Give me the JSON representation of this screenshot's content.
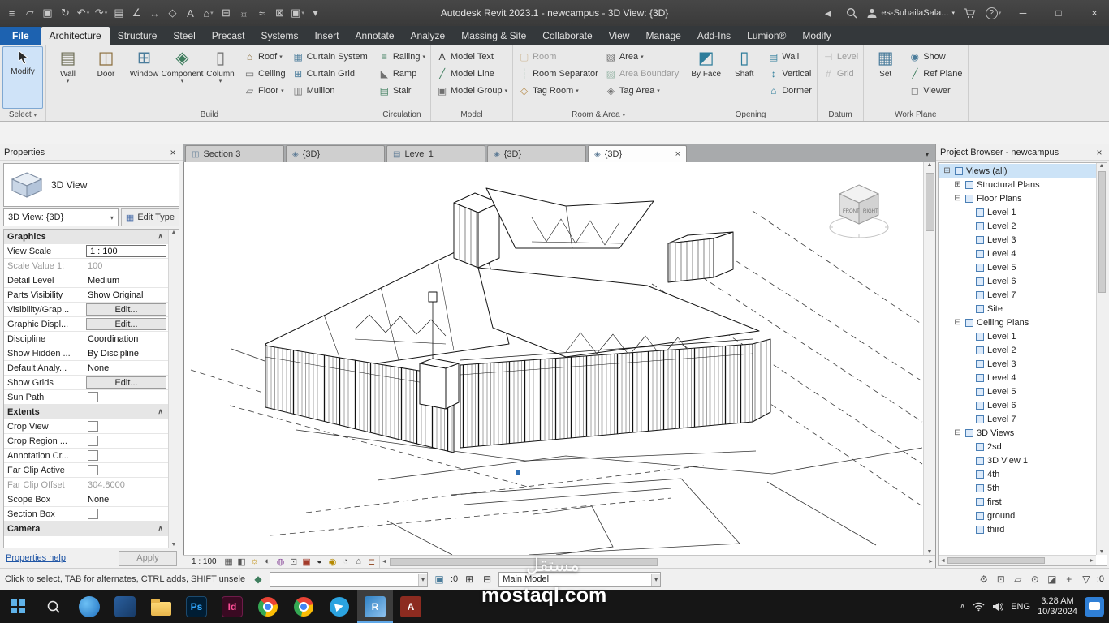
{
  "ui": {
    "arrow": "▾",
    "close": "×",
    "chev": "∧",
    "up": "▲",
    "down": "▼",
    "left": "◄",
    "right": "►",
    "min": "─",
    "max": "□",
    "help": "?"
  },
  "titlebar": {
    "title": "Autodesk Revit 2023.1 - newcampus - 3D View: {3D}",
    "user": "es-SuhailaSala...",
    "qat": [
      {
        "name": "app-menu-icon",
        "glyph": "≡"
      },
      {
        "name": "open-icon",
        "glyph": "▱"
      },
      {
        "name": "save-icon",
        "glyph": "▣"
      },
      {
        "name": "sync-icon",
        "glyph": "↻"
      },
      {
        "name": "undo-icon",
        "glyph": "↶",
        "arrow": true
      },
      {
        "name": "redo-icon",
        "glyph": "↷",
        "arrow": true
      },
      {
        "name": "print-icon",
        "glyph": "▤"
      },
      {
        "name": "measure-icon",
        "glyph": "∠"
      },
      {
        "name": "dimension-icon",
        "glyph": "↔"
      },
      {
        "name": "tag-icon",
        "glyph": "◇"
      },
      {
        "name": "text-icon",
        "glyph": "A"
      },
      {
        "name": "3d-view-icon",
        "glyph": "⌂",
        "arrow": true
      },
      {
        "name": "section-icon",
        "glyph": "⊟"
      },
      {
        "name": "render-icon",
        "glyph": "☼"
      },
      {
        "name": "thin-lines-icon",
        "glyph": "≈"
      },
      {
        "name": "close-hidden-icon",
        "glyph": "⊠"
      },
      {
        "name": "switch-windows-icon",
        "glyph": "▣",
        "arrow": true
      },
      {
        "name": "customize-qat-icon",
        "glyph": "▾"
      }
    ]
  },
  "ribbon": {
    "tabs": [
      {
        "label": "File",
        "cls": "file"
      },
      {
        "label": "Architecture",
        "cls": "sel"
      },
      {
        "label": "Structure"
      },
      {
        "label": "Steel"
      },
      {
        "label": "Precast"
      },
      {
        "label": "Systems"
      },
      {
        "label": "Insert"
      },
      {
        "label": "Annotate"
      },
      {
        "label": "Analyze"
      },
      {
        "label": "Massing & Site"
      },
      {
        "label": "Collaborate"
      },
      {
        "label": "View"
      },
      {
        "label": "Manage"
      },
      {
        "label": "Add-Ins"
      },
      {
        "label": "Lumion®"
      },
      {
        "label": "Modify"
      }
    ],
    "tab_widget_glyph": "⊙",
    "modify_label": "Modify",
    "select_label": "Select",
    "build": {
      "label": "Build",
      "big": [
        {
          "label": "Wall",
          "glyph": "▤",
          "color": "#6f6f58",
          "arrow": true
        },
        {
          "label": "Door",
          "glyph": "◫",
          "color": "#8a6d3b"
        },
        {
          "label": "Window",
          "glyph": "⊞",
          "color": "#4a7c9b"
        },
        {
          "label": "Component",
          "glyph": "◈",
          "color": "#3f7e5e",
          "arrow": true
        },
        {
          "label": "Column",
          "glyph": "▯",
          "color": "#707070",
          "arrow": true
        }
      ],
      "col1": [
        {
          "label": "Roof",
          "glyph": "⌂",
          "color": "#8a6d3b",
          "arrow": true
        },
        {
          "label": "Ceiling",
          "glyph": "▭",
          "color": "#707070"
        },
        {
          "label": "Floor",
          "glyph": "▱",
          "color": "#707070",
          "arrow": true
        }
      ],
      "col2": [
        {
          "label": "Curtain System",
          "glyph": "▦",
          "color": "#4a7c9b"
        },
        {
          "label": "Curtain Grid",
          "glyph": "⊞",
          "color": "#4a7c9b"
        },
        {
          "label": "Mullion",
          "glyph": "▥",
          "color": "#707070"
        }
      ]
    },
    "circulation": {
      "label": "Circulation",
      "items": [
        {
          "label": "Railing",
          "glyph": "≡",
          "color": "#3f7e5e",
          "arrow": true
        },
        {
          "label": "Ramp",
          "glyph": "◣",
          "color": "#707070"
        },
        {
          "label": "Stair",
          "glyph": "▤",
          "color": "#3f7e5e"
        }
      ]
    },
    "model": {
      "label": "Model",
      "items": [
        {
          "label": "Model Text",
          "glyph": "A",
          "color": "#444444"
        },
        {
          "label": "Model Line",
          "glyph": "╱",
          "color": "#3f7e5e"
        },
        {
          "label": "Model Group",
          "glyph": "▣",
          "color": "#707070",
          "arrow": true
        }
      ]
    },
    "room_area": {
      "label": "Room & Area",
      "col1": [
        {
          "label": "Room",
          "glyph": "▢",
          "color": "#b58a4a",
          "cls": "disabled"
        },
        {
          "label": "Room Separator",
          "glyph": "┆",
          "color": "#3f7e5e"
        },
        {
          "label": "Tag Room",
          "glyph": "◇",
          "color": "#b58a4a",
          "arrow": true
        }
      ],
      "col2": [
        {
          "label": "Area",
          "glyph": "▧",
          "color": "#707070",
          "arrow": true
        },
        {
          "label": "Area Boundary",
          "glyph": "▨",
          "color": "#3f7e5e",
          "cls": "disabled"
        },
        {
          "label": "Tag Area",
          "glyph": "◈",
          "color": "#707070",
          "arrow": true
        }
      ]
    },
    "opening": {
      "label": "Opening",
      "big": [
        {
          "label": "By Face",
          "glyph": "◩",
          "color": "#2e7d9b"
        },
        {
          "label": "Shaft",
          "glyph": "▯",
          "color": "#2e7d9b"
        }
      ],
      "small": [
        {
          "label": "Wall",
          "glyph": "▤",
          "color": "#2e7d9b"
        },
        {
          "label": "Vertical",
          "glyph": "↕",
          "color": "#2e7d9b"
        },
        {
          "label": "Dormer",
          "glyph": "⌂",
          "color": "#2e7d9b"
        }
      ]
    },
    "datum": {
      "label": "Datum",
      "items": [
        {
          "label": "Level",
          "glyph": "⊣",
          "color": "#8a8a8a",
          "cls": "disabled"
        },
        {
          "label": "Grid",
          "glyph": "#",
          "color": "#8a8a8a",
          "cls": "disabled"
        }
      ]
    },
    "work_plane": {
      "label": "Work Plane",
      "big": [
        {
          "label": "Set",
          "glyph": "▦",
          "color": "#4a7c9b"
        }
      ],
      "small": [
        {
          "label": "Show",
          "glyph": "◉",
          "color": "#4a7c9b"
        },
        {
          "label": "Ref Plane",
          "glyph": "╱",
          "color": "#3f7e5e"
        },
        {
          "label": "Viewer",
          "glyph": "◻",
          "color": "#707070"
        }
      ]
    }
  },
  "properties": {
    "title": "Properties",
    "type_label": "3D View",
    "instance": "3D View: {3D}",
    "edit_type": "Edit Type",
    "rows": [
      {
        "label": "Graphics",
        "cls": "group",
        "chev": true
      },
      {
        "label": "View Scale",
        "value": "1 : 100",
        "cls": "kind-input"
      },
      {
        "label": "Scale Value   1:",
        "value": "100",
        "cls": "disabled"
      },
      {
        "label": "Detail Level",
        "value": "Medium"
      },
      {
        "label": "Parts Visibility",
        "value": "Show Original"
      },
      {
        "label": "Visibility/Grap...",
        "value": "Edit...",
        "cls": "kind-btn"
      },
      {
        "label": "Graphic Displ...",
        "value": "Edit...",
        "cls": "kind-btn"
      },
      {
        "label": "Discipline",
        "value": "Coordination"
      },
      {
        "label": "Show Hidden ...",
        "value": "By Discipline"
      },
      {
        "label": "Default Analy...",
        "value": "None"
      },
      {
        "label": "Show Grids",
        "value": "Edit...",
        "cls": "kind-btn"
      },
      {
        "label": "Sun Path",
        "cls": "kind-check"
      },
      {
        "label": "Extents",
        "cls": "group",
        "chev": true
      },
      {
        "label": "Crop View",
        "cls": "kind-check"
      },
      {
        "label": "Crop Region ...",
        "cls": "kind-check"
      },
      {
        "label": "Annotation Cr...",
        "cls": "kind-check"
      },
      {
        "label": "Far Clip Active",
        "cls": "kind-check"
      },
      {
        "label": "Far Clip Offset",
        "value": "304.8000",
        "cls": "disabled"
      },
      {
        "label": "Scope Box",
        "value": "None"
      },
      {
        "label": "Section Box",
        "cls": "kind-check"
      },
      {
        "label": "Camera",
        "cls": "group",
        "chev": true
      }
    ],
    "help": "Properties help",
    "apply": "Apply"
  },
  "view_tabs": [
    {
      "label": "Section 3",
      "glyph": "◫",
      "color": "#5f7c96"
    },
    {
      "label": "{3D}",
      "glyph": "◈",
      "color": "#5f7c96"
    },
    {
      "label": "Level 1",
      "glyph": "▤",
      "color": "#5f7c96"
    },
    {
      "label": "{3D}",
      "glyph": "◈",
      "color": "#5f7c96"
    },
    {
      "label": "{3D}",
      "glyph": "◈",
      "color": "#5f7c96",
      "cls": "active",
      "close": true
    }
  ],
  "viewbar": {
    "scale": "1 : 100",
    "icons": [
      {
        "name": "detail-level-icon",
        "glyph": "▦",
        "color": "#555555"
      },
      {
        "name": "visual-style-icon",
        "glyph": "◧",
        "color": "#555555"
      },
      {
        "name": "sun-path-icon",
        "glyph": "☼",
        "color": "#c08a00"
      },
      {
        "name": "shadows-icon",
        "glyph": "◐",
        "color": "#555555"
      },
      {
        "name": "show-rendering-icon",
        "glyph": "◍",
        "color": "#8a4a9b"
      },
      {
        "name": "crop-view-icon",
        "glyph": "⊡",
        "color": "#555555"
      },
      {
        "name": "show-crop-icon",
        "glyph": "▣",
        "color": "#a33a2a"
      },
      {
        "name": "temporary-hide-isolate-icon",
        "glyph": "◒",
        "color": "#333333"
      },
      {
        "name": "reveal-hidden-icon",
        "glyph": "◉",
        "color": "#b58900"
      },
      {
        "name": "temporary-view-properties-icon",
        "glyph": "◔",
        "color": "#555555"
      },
      {
        "name": "displaced-elements-icon",
        "glyph": "⌂",
        "color": "#555555"
      },
      {
        "name": "reveal-constraints-icon",
        "glyph": "⊏",
        "color": "#995533"
      }
    ]
  },
  "viewcube": {
    "front": "FRONT",
    "right": "RIGHT"
  },
  "browser": {
    "title": "Project Browser - newcampus",
    "items": [
      {
        "label": "Views (all)",
        "exp": "⊟",
        "icon": true,
        "ind": 0,
        "cls": "selected"
      },
      {
        "label": "Structural Plans",
        "exp": "⊞",
        "icon": true,
        "ind": 1
      },
      {
        "label": "Floor Plans",
        "exp": "⊟",
        "icon": true,
        "ind": 1
      },
      {
        "label": "Level 1",
        "icon": true,
        "ind": 2
      },
      {
        "label": "Level 2",
        "icon": true,
        "ind": 2
      },
      {
        "label": "Level 3",
        "icon": true,
        "ind": 2
      },
      {
        "label": "Level 4",
        "icon": true,
        "ind": 2
      },
      {
        "label": "Level 5",
        "icon": true,
        "ind": 2
      },
      {
        "label": "Level 6",
        "icon": true,
        "ind": 2
      },
      {
        "label": "Level 7",
        "icon": true,
        "ind": 2
      },
      {
        "label": "Site",
        "icon": true,
        "ind": 2
      },
      {
        "label": "Ceiling Plans",
        "exp": "⊟",
        "icon": true,
        "ind": 1
      },
      {
        "label": "Level 1",
        "icon": true,
        "ind": 2
      },
      {
        "label": "Level 2",
        "icon": true,
        "ind": 2
      },
      {
        "label": "Level 3",
        "icon": true,
        "ind": 2
      },
      {
        "label": "Level 4",
        "icon": true,
        "ind": 2
      },
      {
        "label": "Level 5",
        "icon": true,
        "ind": 2
      },
      {
        "label": "Level 6",
        "icon": true,
        "ind": 2
      },
      {
        "label": "Level 7",
        "icon": true,
        "ind": 2
      },
      {
        "label": "3D Views",
        "exp": "⊟",
        "icon": true,
        "ind": 1
      },
      {
        "label": "2sd",
        "icon": true,
        "ind": 2
      },
      {
        "label": "3D View 1",
        "icon": true,
        "ind": 2
      },
      {
        "label": "4th",
        "icon": true,
        "ind": 2
      },
      {
        "label": "5th",
        "icon": true,
        "ind": 2
      },
      {
        "label": "first",
        "icon": true,
        "ind": 2
      },
      {
        "label": "ground",
        "icon": true,
        "ind": 2
      },
      {
        "label": "third",
        "icon": true,
        "ind": 2
      }
    ]
  },
  "status": {
    "message": "Click to select, TAB for alternates, CTRL adds, SHIFT unsele",
    "press_drag_glyph": "◆",
    "editing_requests_glyph": "▣",
    "count_editable": ":0",
    "worksets_glyph": "⊞",
    "design_options_glyph": "⊟",
    "main_model": "Main Model",
    "right_icons": [
      {
        "name": "background-processes-icon",
        "glyph": "⚙",
        "color": "#555555"
      },
      {
        "name": "select-links-icon",
        "glyph": "⊡",
        "color": "#555555"
      },
      {
        "name": "select-underlay-icon",
        "glyph": "▱",
        "color": "#555555"
      },
      {
        "name": "select-pinned-icon",
        "glyph": "⊙",
        "color": "#555555"
      },
      {
        "name": "select-by-face-icon",
        "glyph": "◪",
        "color": "#555555"
      },
      {
        "name": "drag-on-selection-icon",
        "glyph": "+",
        "color": "#555555"
      }
    ],
    "filter_glyph": "▽",
    "count_filter": ":0"
  },
  "taskbar": {
    "ps": "Ps",
    "id": "Id",
    "revit": "R",
    "acad": "A",
    "lang": "ENG",
    "time": "3:28 AM",
    "date": "10/3/2024"
  },
  "watermark": {
    "latin": "mostaql.com",
    "arabic": "مستقل"
  }
}
